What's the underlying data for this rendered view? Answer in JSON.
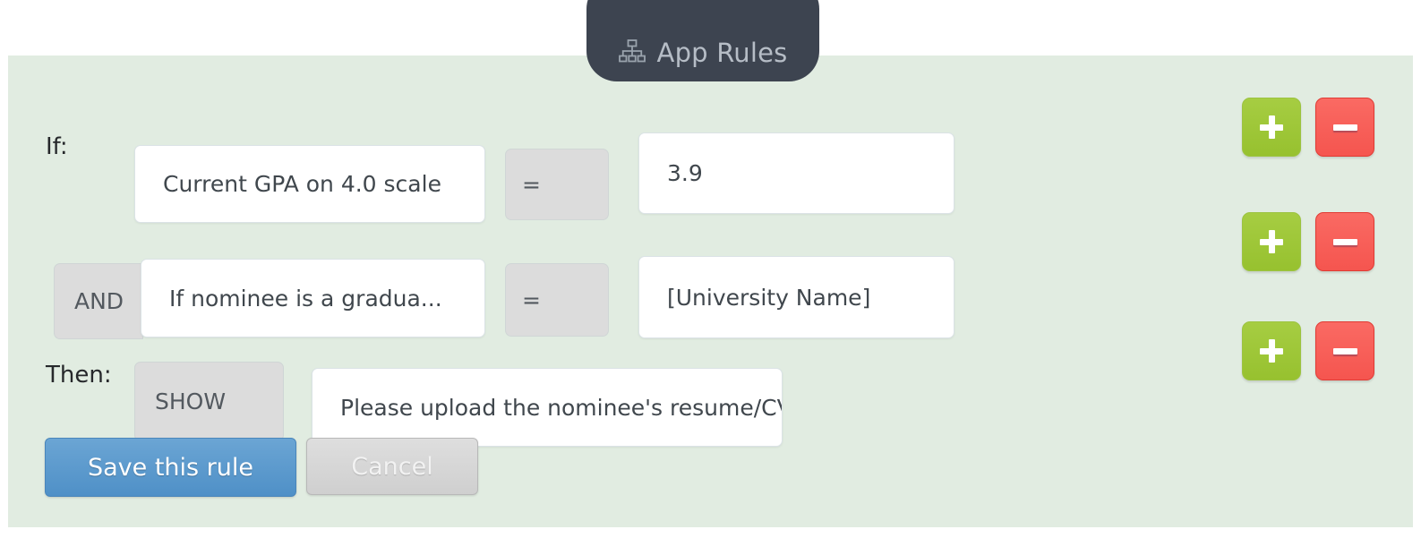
{
  "tab": {
    "label": "App Rules",
    "icon": "sitemap-icon"
  },
  "colors": {
    "panel_background": "#e1ece1",
    "tab_background": "#3d4450",
    "add_button": "#9cc341",
    "remove_button": "#f5554f",
    "save_button": "#5b9bd0",
    "cancel_button": "#d4d4d4"
  },
  "rule": {
    "conditions": [
      {
        "prefix_label": "If:",
        "connector": null,
        "field": "Current GPA on 4.0 scale",
        "operator": "=",
        "value": "3.9",
        "add_label": "+",
        "remove_label": "−"
      },
      {
        "prefix_label": "",
        "connector": "AND",
        "field": "If nominee is a gradua...",
        "operator": "=",
        "value": "[University Name]",
        "add_label": "+",
        "remove_label": "−"
      }
    ],
    "action": {
      "prefix_label": "Then:",
      "type": "SHOW",
      "target": "Please upload the nominee's resume/CV...",
      "add_label": "+",
      "remove_label": "−"
    }
  },
  "footer": {
    "save_label": "Save this rule",
    "cancel_label": "Cancel"
  }
}
